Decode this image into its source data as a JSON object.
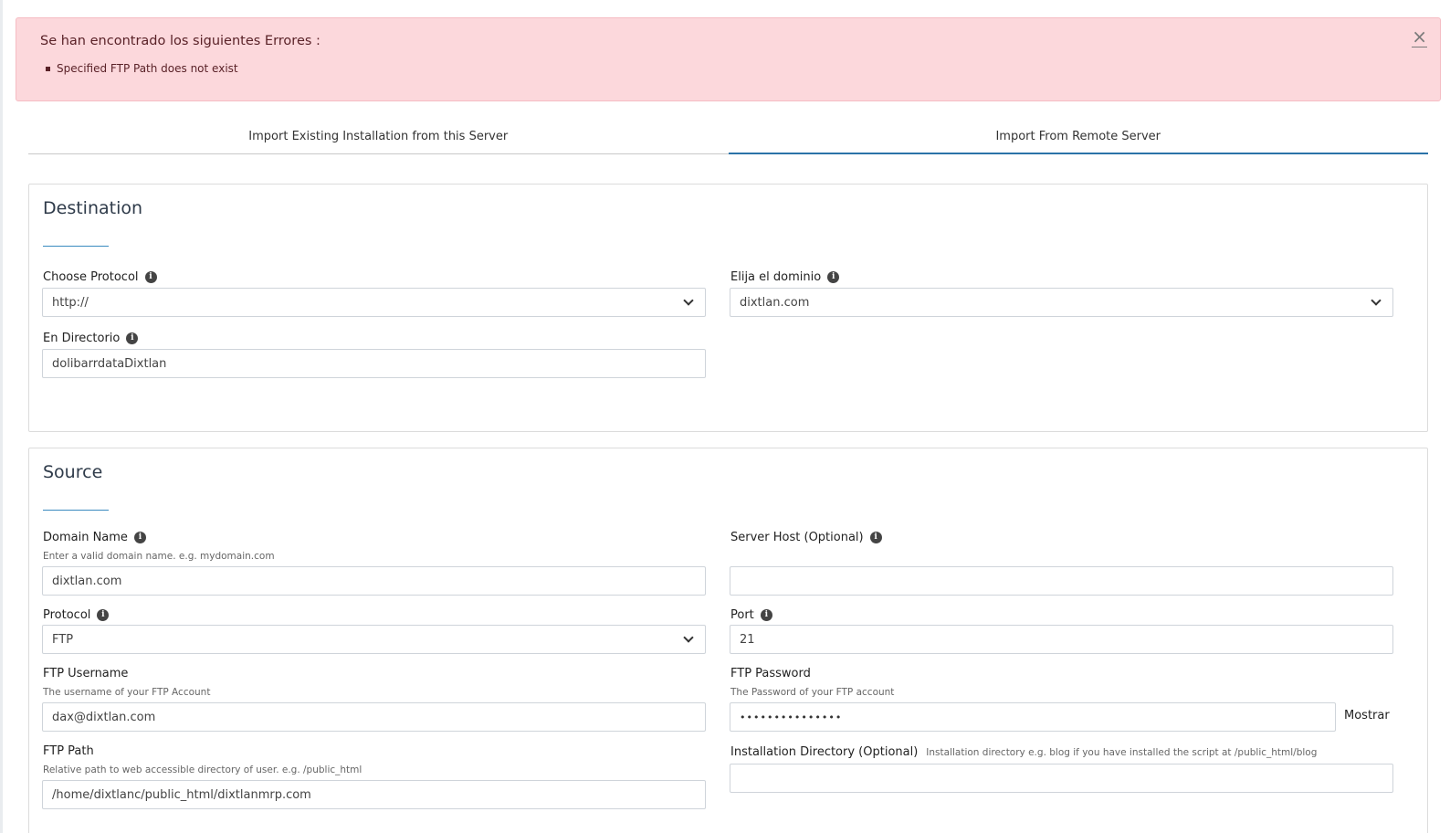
{
  "alert": {
    "title": "Se han encontrado los siguientes Errores :",
    "errors": [
      "Specified FTP Path does not exist"
    ],
    "close_symbol": "×"
  },
  "tabs": [
    {
      "label": "Import Existing Installation from this Server",
      "active": false
    },
    {
      "label": "Import From Remote Server",
      "active": true
    }
  ],
  "destination": {
    "title": "Destination",
    "protocol": {
      "label": "Choose Protocol",
      "value": "http://"
    },
    "domain": {
      "label": "Elija el dominio",
      "value": "dixtlan.com"
    },
    "directory": {
      "label": "En Directorio",
      "value": "dolibarrdataDixtlan"
    }
  },
  "source": {
    "title": "Source",
    "domain_name": {
      "label": "Domain Name",
      "hint": "Enter a valid domain name. e.g. mydomain.com",
      "value": "dixtlan.com"
    },
    "server_host": {
      "label": "Server Host (Optional)",
      "value": ""
    },
    "protocol": {
      "label": "Protocol",
      "value": "FTP"
    },
    "port": {
      "label": "Port",
      "value": "21"
    },
    "ftp_username": {
      "label": "FTP Username",
      "hint": "The username of your FTP Account",
      "value": "dax@dixtlan.com"
    },
    "ftp_password": {
      "label": "FTP Password",
      "hint": "The Password of your FTP account",
      "value": "•••••••••••••••",
      "show_label": "Mostrar"
    },
    "ftp_path": {
      "label": "FTP Path",
      "hint": "Relative path to web accessible directory of user. e.g. /public_html",
      "value": "/home/dixtlanc/public_html/dixtlanmrp.com"
    },
    "install_dir": {
      "label": "Installation Directory (Optional)",
      "hint": "Installation directory e.g. blog if you have installed the script at /public_html/blog",
      "value": ""
    }
  },
  "colors": {
    "accent": "#2b73a8",
    "alert_bg": "#fcd8dc",
    "alert_text": "#5a2228"
  }
}
